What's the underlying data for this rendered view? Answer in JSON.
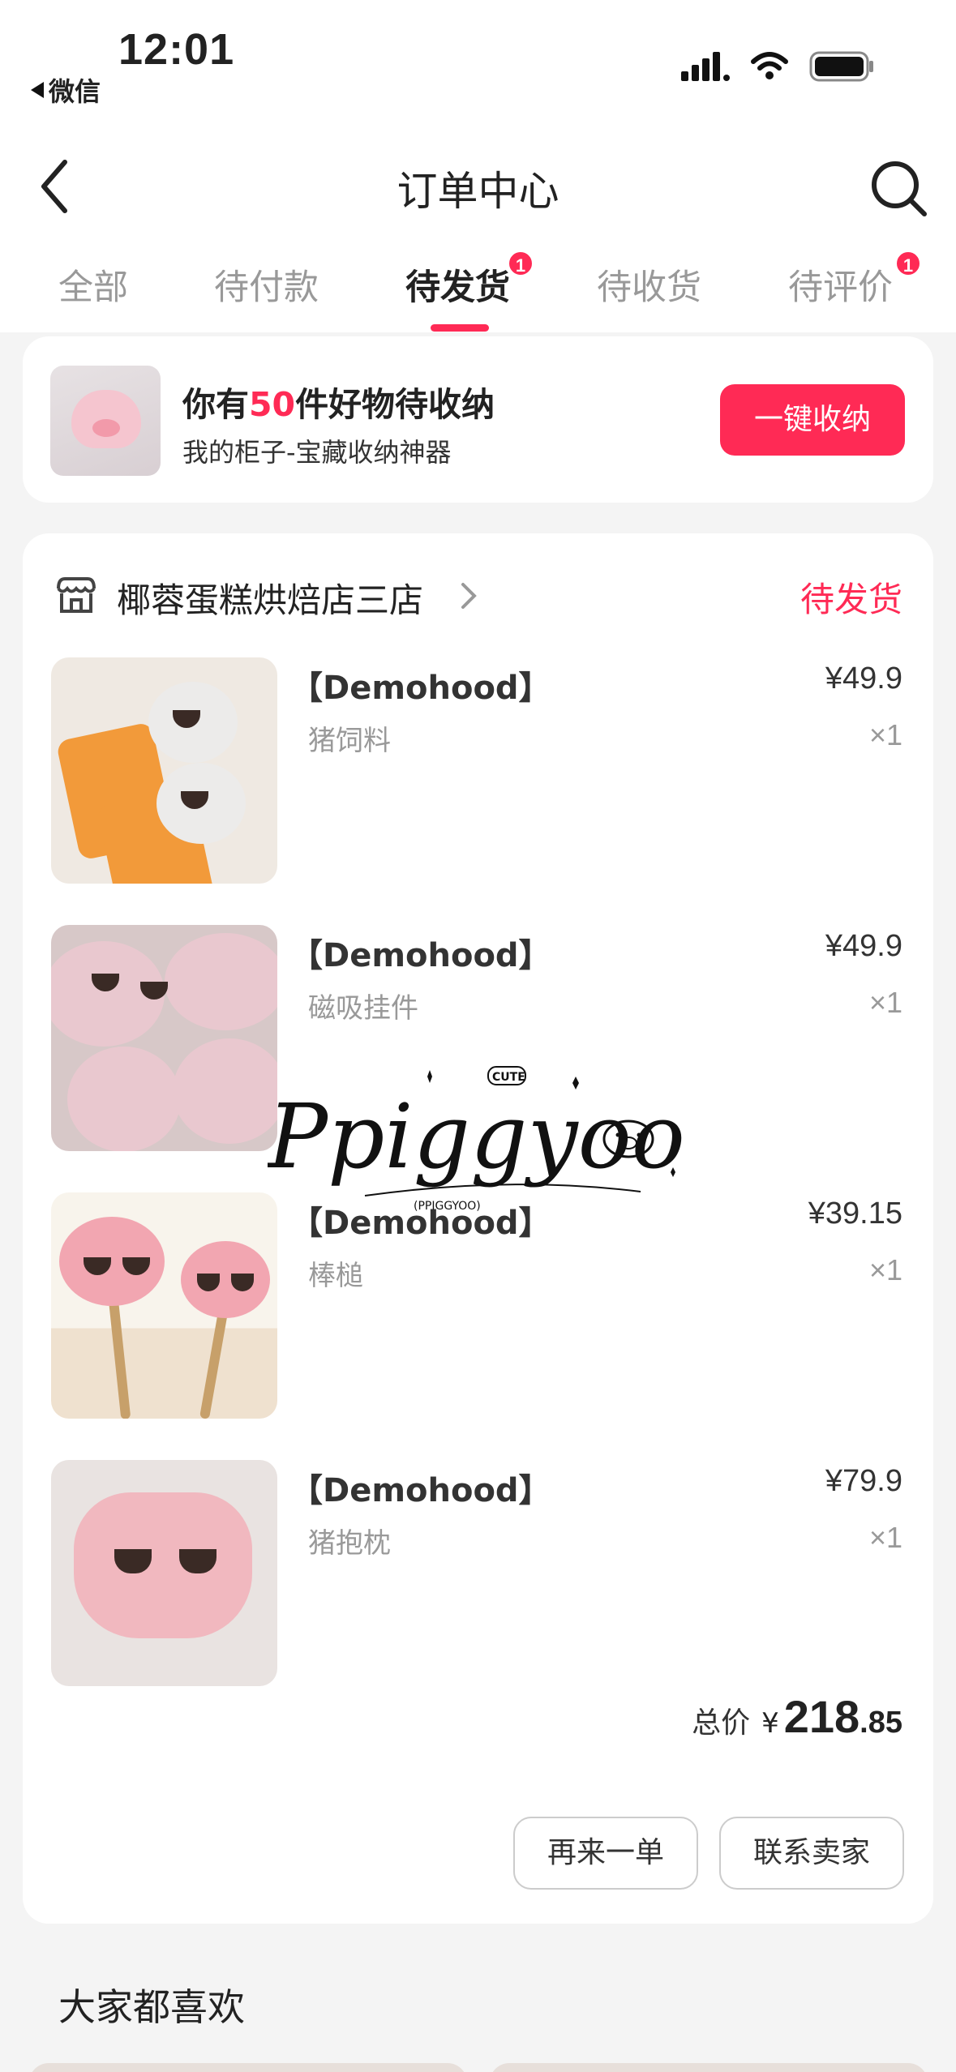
{
  "status_bar": {
    "time": "12:01",
    "back_app_label": "微信"
  },
  "header": {
    "title": "订单中心"
  },
  "tabs": [
    {
      "label": "全部",
      "badge": null
    },
    {
      "label": "待付款",
      "badge": null
    },
    {
      "label": "待发货",
      "badge": "1",
      "active": true
    },
    {
      "label": "待收货",
      "badge": null
    },
    {
      "label": "待评价",
      "badge": "1"
    }
  ],
  "promo": {
    "title_before": "你有",
    "count": "50",
    "title_after": "件好物待收纳",
    "subtitle": "我的柜子-宝藏收纳神器",
    "button_label": "一键收纳"
  },
  "order": {
    "shop_name": "椰蓉蛋糕烘焙店三店",
    "status": "待发货",
    "items": [
      {
        "brand": "【Demohood】",
        "name": "猪饲料",
        "price": "¥49.9",
        "qty": "×1"
      },
      {
        "brand": "【Demohood】",
        "name": "磁吸挂件",
        "price": "¥49.9",
        "qty": "×1"
      },
      {
        "brand": "【Demohood】",
        "name": "棒槌",
        "price": "¥39.15",
        "qty": "×1"
      },
      {
        "brand": "【Demohood】",
        "name": "猪抱枕",
        "price": "¥79.9",
        "qty": "×1"
      }
    ],
    "total_label": "总价",
    "total_currency": "¥",
    "total_integer": "218",
    "total_decimal": ".85",
    "reorder_label": "再来一单",
    "contact_label": "联系卖家"
  },
  "watermark": {
    "script_text": "Ppiggyoo",
    "badge_text": "CUTE",
    "sub_text": "(PPIGGYOO)"
  },
  "recommend": {
    "title": "大家都喜欢"
  },
  "colors": {
    "accent": "#ff2a55",
    "background": "#f4f4f4",
    "card": "#ffffff",
    "muted_text": "#999999"
  }
}
